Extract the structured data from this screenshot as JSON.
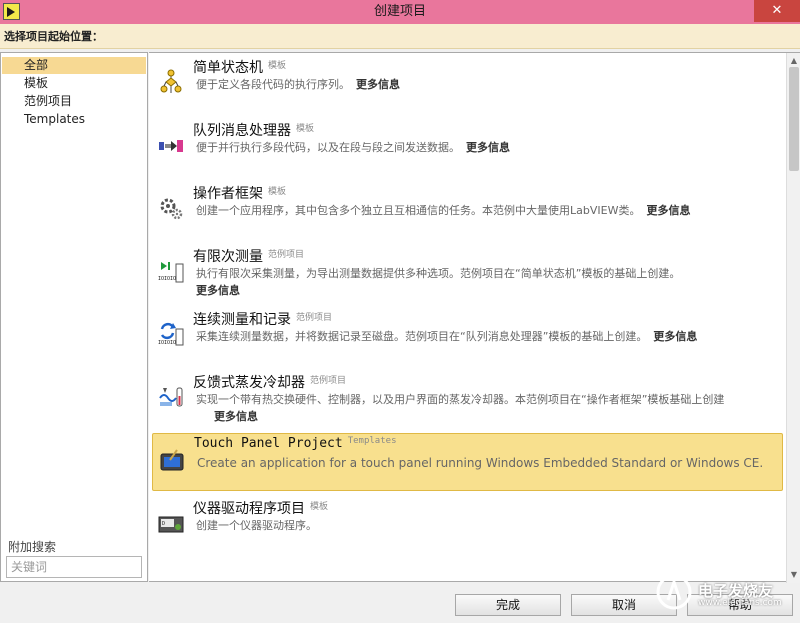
{
  "window": {
    "title": "创建项目",
    "close_glyph": "✕"
  },
  "header": {
    "label": "选择项目起始位置："
  },
  "sidebar": {
    "items": [
      {
        "label": "全部",
        "selected": true
      },
      {
        "label": "模板"
      },
      {
        "label": "范例项目"
      },
      {
        "label": "Templates"
      }
    ]
  },
  "search": {
    "label": "附加搜索",
    "placeholder": "关键词"
  },
  "projects": [
    {
      "name": "简单状态机",
      "tag": "模板",
      "desc": "便于定义各段代码的执行序列。",
      "more": "更多信息",
      "icon": "state-machine-icon"
    },
    {
      "name": "队列消息处理器",
      "tag": "模板",
      "desc": "便于并行执行多段代码，以及在段与段之间发送数据。",
      "more": "更多信息",
      "icon": "queued-message-handler-icon"
    },
    {
      "name": "操作者框架",
      "tag": "模板",
      "desc": "创建一个应用程序，其中包含多个独立且互相通信的任务。本范例中大量使用LabVIEW类。",
      "more": "更多信息",
      "icon": "gears-icon"
    },
    {
      "name": "有限次测量",
      "tag": "范例项目",
      "desc": "执行有限次采集测量，为导出测量数据提供多种选项。范例项目在“简单状态机”模板的基础上创建。",
      "more": "更多信息",
      "icon": "finite-measurement-icon"
    },
    {
      "name": "连续测量和记录",
      "tag": "范例项目",
      "desc": "采集连续测量数据，并将数据记录至磁盘。范例项目在“队列消息处理器”模板的基础上创建。",
      "more": "更多信息",
      "icon": "continuous-measurement-icon"
    },
    {
      "name": "反馈式蒸发冷却器",
      "tag": "范例项目",
      "desc": "实现一个带有热交换硬件、控制器，以及用户界面的蒸发冷却器。本范例项目在“操作者框架”模板基础上创建",
      "more": "更多信息",
      "icon": "evaporative-cooler-icon"
    },
    {
      "name": "Touch Panel Project",
      "tag": "Templates",
      "desc": "Create an application for a touch panel running Windows Embedded Standard or Windows CE.",
      "more": "",
      "icon": "touch-panel-icon",
      "selected": true
    },
    {
      "name": "仪器驱动程序项目",
      "tag": "模板",
      "desc": "创建一个仪器驱动程序。",
      "more": "",
      "icon": "instrument-driver-icon"
    }
  ],
  "footer": {
    "finish_label": "完成",
    "cancel_label": "取消",
    "help_label": "帮助"
  },
  "watermark": {
    "text": "电子发烧友",
    "sub": "www.elecfans.com"
  },
  "colors": {
    "titlebar": "#e9769c",
    "selection": "#f8e08e",
    "sidebar_selection": "#f7d993"
  }
}
